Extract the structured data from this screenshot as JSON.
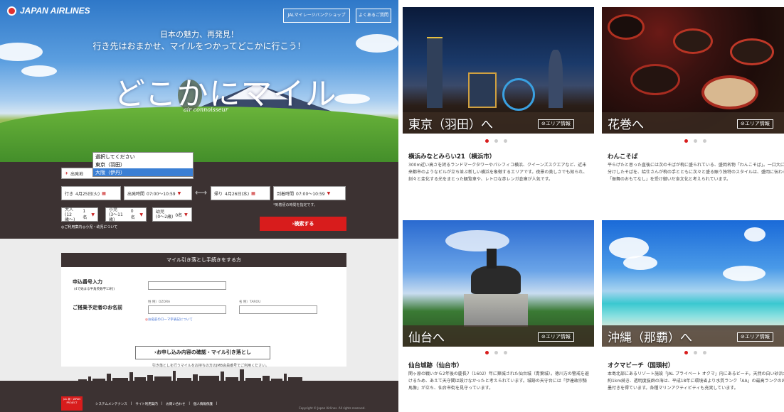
{
  "header": {
    "brand": "JAPAN AIRLINES",
    "btn_mileage_shop": "JALマイレージバンクショップ",
    "btn_faq": "よくあるご質問"
  },
  "hero": {
    "catch_line1": "日本の魅力、再発見！",
    "catch_line2": "行き先はおまかせ、マイルをつかってどこかに行こう！",
    "big_title": "どこかにマイル",
    "big_sub": "air connoisseur"
  },
  "booking": {
    "departure_label": "出発地",
    "dropdown_options": [
      "選択してください",
      "東京（羽田）",
      "大阪（伊丹）"
    ],
    "dropdown_selected": "大阪（伊丹）",
    "outbound_label": "行き",
    "outbound_date": "4月25日(火)",
    "dep_time_label": "出発時間",
    "dep_time": "07:00〜10:59",
    "return_label": "帰り",
    "return_date": "4月26日(水)",
    "arr_time_label": "到着時間",
    "arr_time": "07:00〜10:59",
    "time_note": "*到着便の時間を指定です。",
    "adult_label": "大人",
    "adult_sub": "(12歳〜)",
    "adult_count": "1名",
    "child_label": "小児",
    "child_sub": "(3〜11歳)",
    "child_count": "0名",
    "infant_label": "幼児",
    "infant_sub": "(0〜2歳)",
    "infant_count": "0名",
    "link_help1": "ご利用案内",
    "link_help2": "小児・幼児について",
    "search_button": "検索する"
  },
  "form": {
    "header": "マイル引き落とし手続きをする方",
    "app_no_label": "申込番号入力",
    "app_no_note": "(4で始まる半角英数字13桁)",
    "name_label": "ご搭乗予定者のお名前",
    "sei_example": "姓 例）OZORA",
    "mei_example": "名 例）TAROU",
    "romaji_link": "お名前のローマ字表記について",
    "confirm_button": "お申し込み内容の確認・マイル引き落とし",
    "confirm_note": "引き落としを行うマイルをお持ちの方のJMB会員番号でご利用ください。"
  },
  "footer": {
    "project_badge": "JAL 新・JAPAN PROJECT",
    "links": [
      "システムメンテナンス",
      "サイト利用案内",
      "お問い合わせ",
      "個人情報保護"
    ],
    "copyright": "Copyright © Japan Airlines. All rights reserved."
  },
  "cards": [
    {
      "title": "東京（羽田）へ",
      "area_button": "エリア情報",
      "heading": "横浜みなとみらい21（横浜市）",
      "body": "300m近い高さを誇るランドマークタワーやパシフィコ横浜、クイーンズスクエアなど、近未来都市のようなビルが立ち並ぶ新しい横浜を象徴するエリアです。夜景の美しさでも知られ、刻々と変化する光をまとった観覧車や、レトロな赤レンガ倉庫が人気です。"
    },
    {
      "title": "花巻へ",
      "area_button": "エリア情報",
      "heading": "わんこそば",
      "body": "平らげたと思った直後には次のそばが椀に盛られている、盛岡名物「わんこそば」。一口大に小分けしたそばを、給仕さんが椀の手とともに次々と盛る賑う独特のスタイルは、盛岡に伝わる「振舞のおもてなし」を受け継いだ食文化と考えられています。"
    },
    {
      "title": "仙台へ",
      "area_button": "エリア情報",
      "heading": "仙台城跡（仙台市）",
      "body": "関ヶ原の戦いから2年後の慶長7（1602）年に築城された仙台城（青葉城）。徳川方の警戒を避けるため、あえて天守閣は設けなかったと考えられています。城跡の天守台には「伊達政宗騎馬像」が立ち、仙台市街を見守っています。"
    },
    {
      "title": "沖縄（那覇）へ",
      "area_button": "エリア情報",
      "heading": "オクマビーチ（国頭村）",
      "body": "本島北部にあるリゾート施設「JAL プライベート オクマ」内にあるビーチ。天然の白い砂浜が約1km続き、透明度抜群の海は、平成18年に環境省より水質ランク「AA」の最高ランクのお墨付きを得ています。各種マリンアクティビティも充実しています。"
    }
  ],
  "colors": {
    "brand_red": "#d81c1c",
    "dark_brown": "#3c3232",
    "form_bg": "#ececec"
  }
}
